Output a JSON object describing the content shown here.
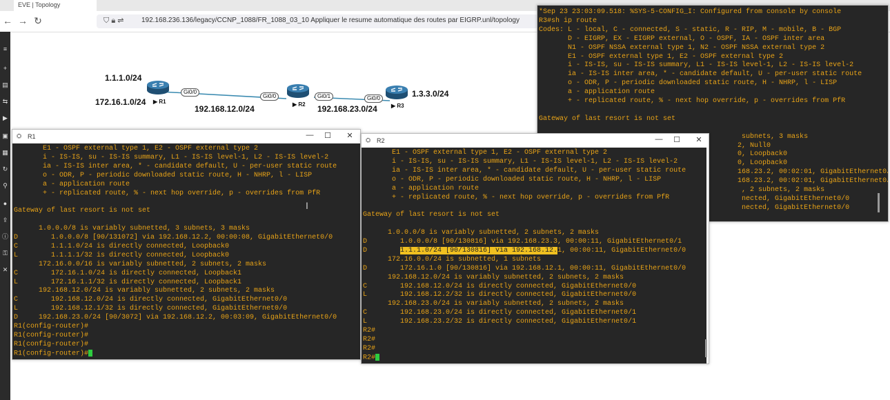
{
  "browser": {
    "tab_title": "EVE | Topology",
    "url": "192.168.236.136/legacy/CCNP_1088/FR_1088_03_10 Appliquer le resume automatique des routes par EIGRP.unl/topology"
  },
  "topology": {
    "r1_net_top": "1.1.1.0/24",
    "r1_net_left": "172.16.1.0/24",
    "link12": "192.168.12.0/24",
    "link23": "192.168.23.0/24",
    "r3_net": "1.3.3.0/24",
    "r1_name": "R1",
    "r2_name": "R2",
    "r3_name": "R3",
    "r1_if": "Gi0/0",
    "r2_if0": "Gi0/0",
    "r2_if1": "Gi0/1",
    "r3_if": "Gi0/0"
  },
  "r3_window": {
    "lines": [
      "*Sep 23 23:03:09.518: %SYS-5-CONFIG_I: Configured from console by console",
      "R3#sh ip route",
      "Codes: L - local, C - connected, S - static, R - RIP, M - mobile, B - BGP",
      "       D - EIGRP, EX - EIGRP external, O - OSPF, IA - OSPF inter area",
      "       N1 - OSPF NSSA external type 1, N2 - OSPF NSSA external type 2",
      "       E1 - OSPF external type 1, E2 - OSPF external type 2",
      "       i - IS-IS, su - IS-IS summary, L1 - IS-IS level-1, L2 - IS-IS level-2",
      "       ia - IS-IS inter area, * - candidate default, U - per-user static route",
      "       o - ODR, P - periodic downloaded static route, H - NHRP, l - LISP",
      "       a - application route",
      "       + - replicated route, % - next hop override, p - overrides from PfR",
      "",
      "Gateway of last resort is not set",
      "",
      "                                                 subnets, 3 masks",
      "                                                2, Null0",
      "                                                0, Loopback0",
      "                                                0, Loopback0",
      "                                                168.23.2, 00:02:01, GigabitEthernet0/0",
      "                                                168.23.2, 00:02:01, GigabitEthernet0/0",
      "                                                 , 2 subnets, 2 masks",
      "                                                 nected, GigabitEthernet0/0",
      "                                                 nected, GigabitEthernet0/0"
    ]
  },
  "r1_window": {
    "title": "R1",
    "lines": [
      "       E1 - OSPF external type 1, E2 - OSPF external type 2",
      "       i - IS-IS, su - IS-IS summary, L1 - IS-IS level-1, L2 - IS-IS level-2",
      "       ia - IS-IS inter area, * - candidate default, U - per-user static route",
      "       o - ODR, P - periodic downloaded static route, H - NHRP, l - LISP",
      "       a - application route",
      "       + - replicated route, % - next hop override, p - overrides from PfR",
      "",
      "Gateway of last resort is not set",
      "",
      "      1.0.0.0/8 is variably subnetted, 3 subnets, 3 masks",
      "D        1.0.0.0/8 [90/131072] via 192.168.12.2, 00:00:08, GigabitEthernet0/0",
      "C        1.1.1.0/24 is directly connected, Loopback0",
      "L        1.1.1.1/32 is directly connected, Loopback0",
      "      172.16.0.0/16 is variably subnetted, 2 subnets, 2 masks",
      "C        172.16.1.0/24 is directly connected, Loopback1",
      "L        172.16.1.1/32 is directly connected, Loopback1",
      "      192.168.12.0/24 is variably subnetted, 2 subnets, 2 masks",
      "C        192.168.12.0/24 is directly connected, GigabitEthernet0/0",
      "L        192.168.12.1/32 is directly connected, GigabitEthernet0/0",
      "D     192.168.23.0/24 [90/3072] via 192.168.12.2, 00:03:09, GigabitEthernet0/0",
      "R1(config-router)#",
      "R1(config-router)#",
      "R1(config-router)#",
      "R1(config-router)#"
    ]
  },
  "r2_window": {
    "title": "R2",
    "lines": [
      "       E1 - OSPF external type 1, E2 - OSPF external type 2",
      "       i - IS-IS, su - IS-IS summary, L1 - IS-IS level-1, L2 - IS-IS level-2",
      "       ia - IS-IS inter area, * - candidate default, U - per-user static route",
      "       o - ODR, P - periodic downloaded static route, H - NHRP, l - LISP",
      "       a - application route",
      "       + - replicated route, % - next hop override, p - overrides from PfR",
      "",
      "Gateway of last resort is not set",
      "",
      "      1.0.0.0/8 is variably subnetted, 2 subnets, 2 masks",
      "D        1.0.0.0/8 [90/130816] via 192.168.23.3, 00:00:11, GigabitEthernet0/1",
      "D        1.1.1.0/24 [90/130816] via 192.168.12.1, 00:00:11, GigabitEthernet0/0",
      "      172.16.0.0/24 is subnetted, 1 subnets",
      "D        172.16.1.0 [90/130816] via 192.168.12.1, 00:00:11, GigabitEthernet0/0",
      "      192.168.12.0/24 is variably subnetted, 2 subnets, 2 masks",
      "C        192.168.12.0/24 is directly connected, GigabitEthernet0/0",
      "L        192.168.12.2/32 is directly connected, GigabitEthernet0/0",
      "      192.168.23.0/24 is variably subnetted, 2 subnets, 2 masks",
      "C        192.168.23.0/24 is directly connected, GigabitEthernet0/1",
      "L        192.168.23.2/32 is directly connected, GigabitEthernet0/1",
      "R2#",
      "R2#",
      "R2#",
      "R2#"
    ]
  },
  "colors": {
    "terminal_bg": "#262626",
    "terminal_text": "#e8a317",
    "highlight": "#f0c020",
    "cursor": "#2ecc40"
  }
}
